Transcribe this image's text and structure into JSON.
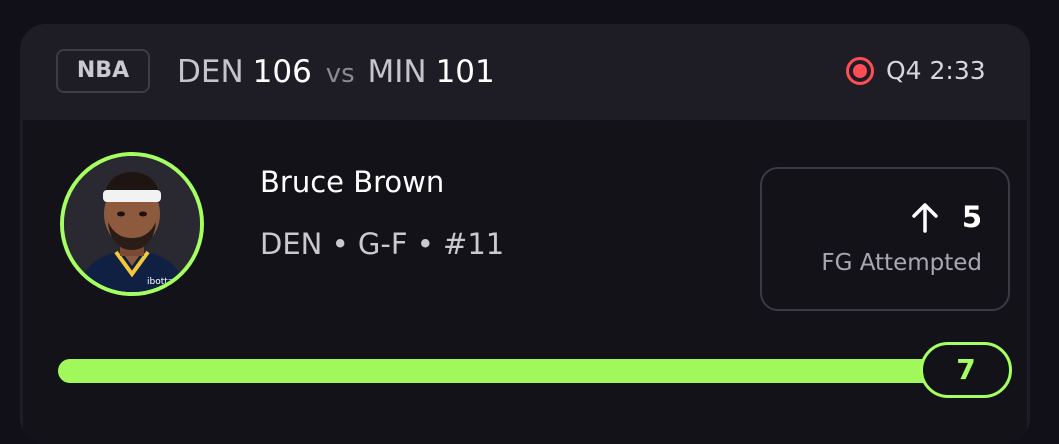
{
  "header": {
    "league": "NBA",
    "home_team": "DEN",
    "home_score": "106",
    "vs": "vs",
    "away_team": "MIN",
    "away_score": "101",
    "live_icon": "live-record-icon",
    "clock": "Q4 2:33"
  },
  "player": {
    "name": "Bruce Brown",
    "meta": "DEN • G-F • #11",
    "jersey_wordmark": "ibotta"
  },
  "stat": {
    "direction_icon": "arrow-up-icon",
    "value": "5",
    "label": "FG Attempted"
  },
  "progress": {
    "line": "7",
    "fill_fraction": 1.0
  },
  "colors": {
    "accent": "#a5ff60",
    "live": "#ff4d55",
    "card": "#1e1d26",
    "background": "#111019"
  }
}
